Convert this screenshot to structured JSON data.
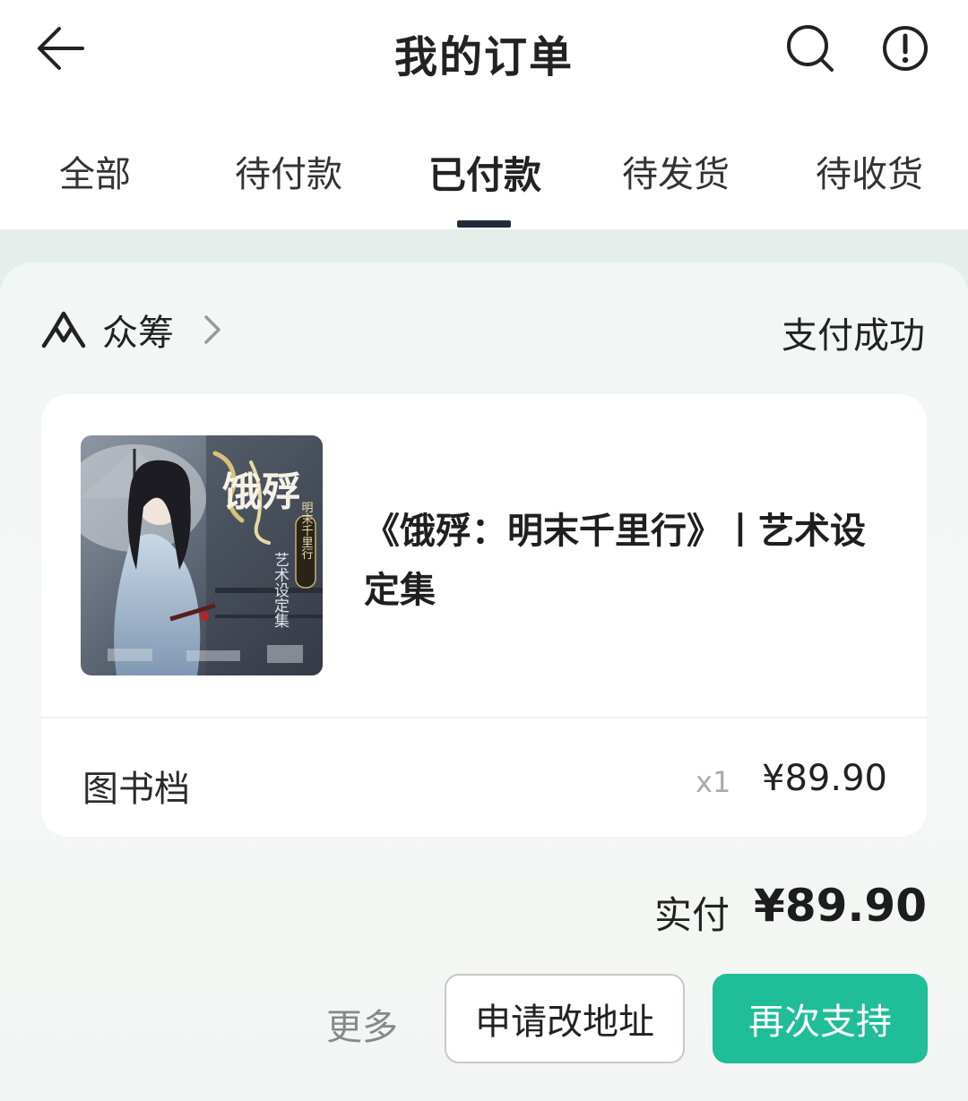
{
  "header": {
    "title": "我的订单",
    "back_icon": "arrow-left-icon",
    "search_icon": "search-icon",
    "info_icon": "info-circle-icon"
  },
  "tabs": [
    {
      "label": "全部",
      "active": false
    },
    {
      "label": "待付款",
      "active": false
    },
    {
      "label": "已付款",
      "active": true
    },
    {
      "label": "待发货",
      "active": false
    },
    {
      "label": "待收货",
      "active": false
    }
  ],
  "order": {
    "shop_name": "众筹",
    "status": "支付成功",
    "item": {
      "title": "《饿殍：明末千里行》丨艺术设定集",
      "cover_title": "饿殍",
      "cover_subtitle": "明末千里行",
      "cover_caption": "艺术设定集",
      "spec": "图书档",
      "quantity": "x1",
      "price": "¥89.90"
    },
    "paid_label": "实付",
    "paid_amount": "¥89.90"
  },
  "actions": {
    "more_label": "更多",
    "change_address_label": "申请改地址",
    "support_again_label": "再次支持"
  },
  "colors": {
    "accent": "#1fbd98",
    "background": "#eef2f1",
    "tab_indicator": "#222b3a"
  }
}
